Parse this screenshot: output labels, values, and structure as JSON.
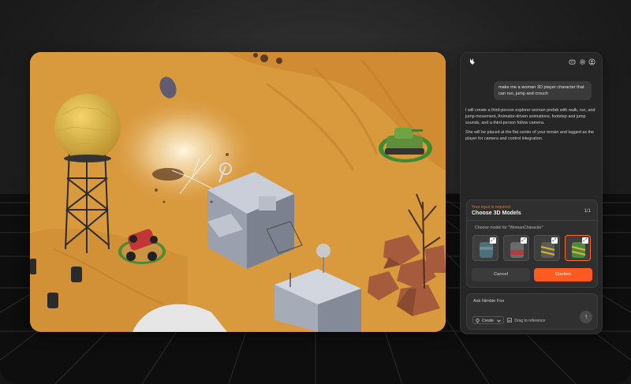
{
  "chat": {
    "user_message": "make me a woman 3D player character that can run, jump and crouch",
    "ai_message_1": "I will create a third-person explorer woman prefab with walk, run, and jump movement, Animator-driven animations, footstep and jump sounds, and a third-person follow camera.",
    "ai_message_2": "She will be placed at the flat center of your terrain and tagged as the player for camera and control integration."
  },
  "card": {
    "required": "Your input is required",
    "title": "Choose 3D Models",
    "count": "1/1",
    "label": "Choose model for \"WomanCharacter\"",
    "cancel": "Cancel",
    "confirm": "Confirm"
  },
  "input": {
    "placeholder": "Ask Nimble Fox",
    "mode": "Create",
    "drag": "Drag to reference"
  },
  "icons": {
    "logo": "fox-logo-icon",
    "discord": "discord-icon",
    "settings": "gear-icon",
    "account": "user-icon",
    "send": "arrow-up-icon",
    "expand": "expand-icon",
    "mode_chevron": "chevron-down-icon",
    "drag": "image-icon",
    "mode": "lightbulb-icon"
  },
  "colors": {
    "accent": "#ff5a1f",
    "panel": "#262626",
    "sand": "#d8973c"
  }
}
